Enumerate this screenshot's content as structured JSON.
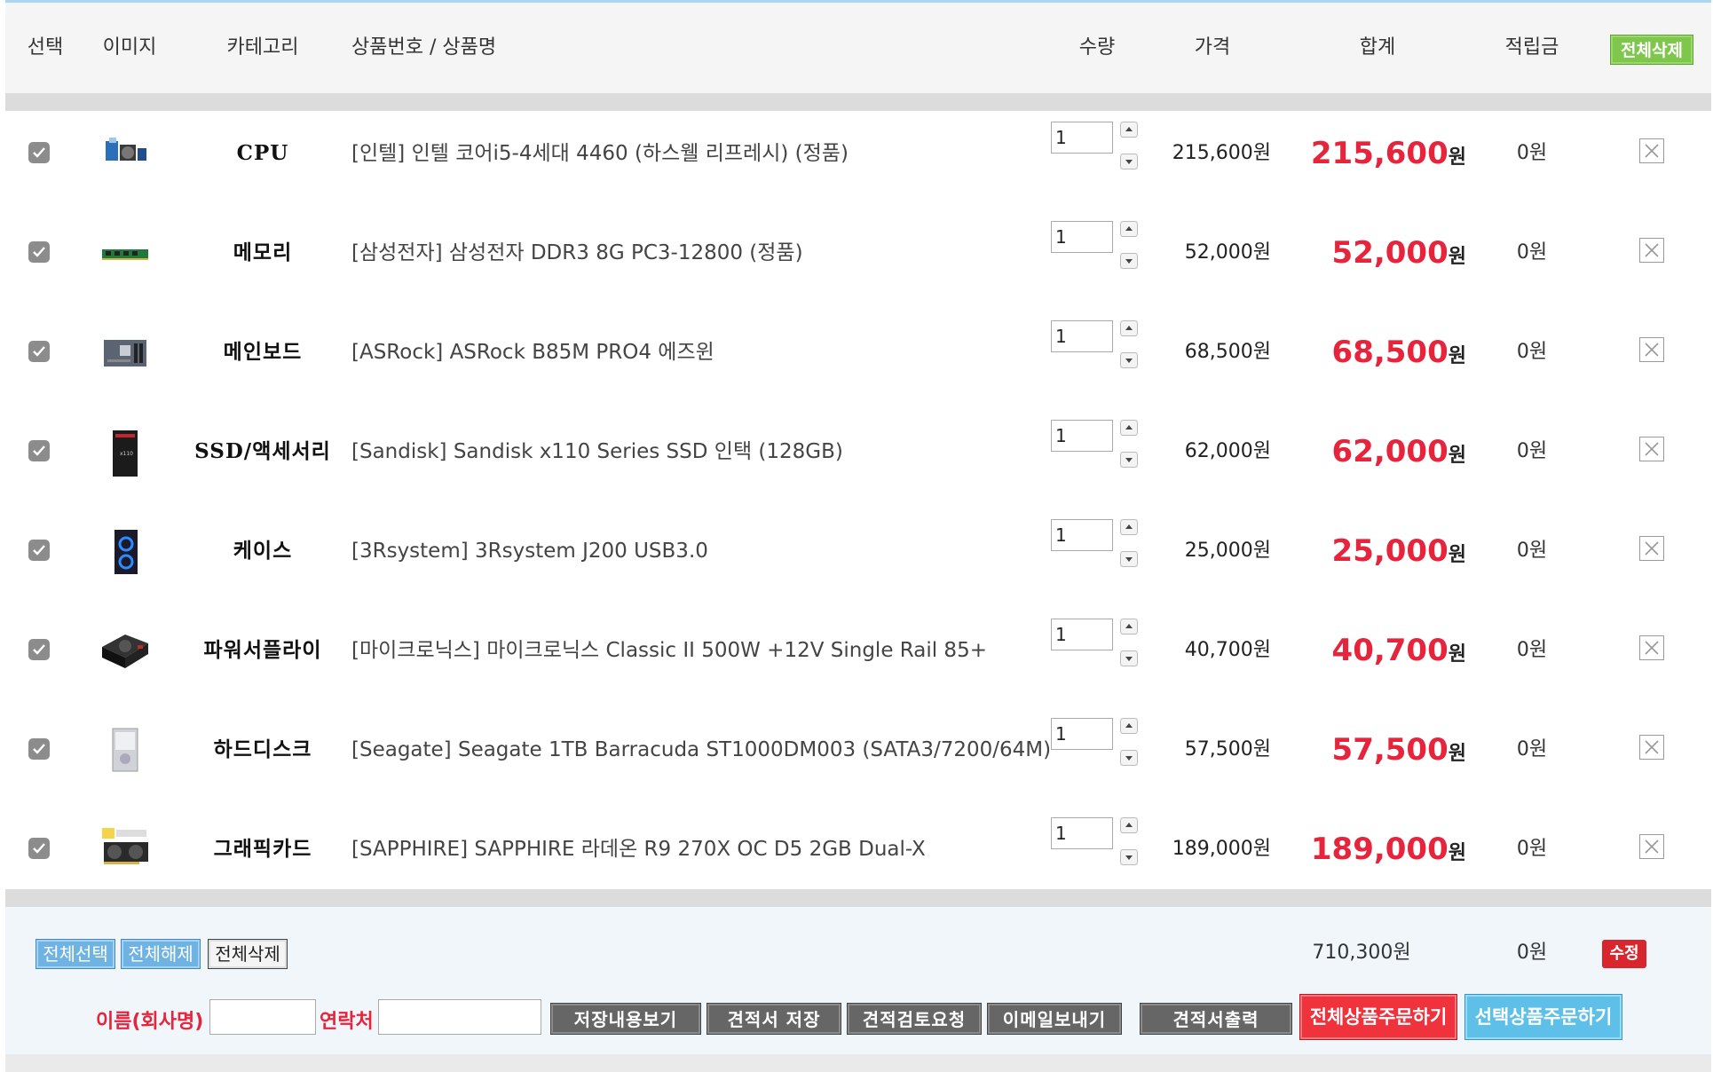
{
  "header": {
    "col_select": "선택",
    "col_image": "이미지",
    "col_category": "카테고리",
    "col_product": "상품번호 / 상품명",
    "col_qty": "수량",
    "col_price": "가격",
    "col_total": "합계",
    "col_points": "적립금",
    "delete_all_label": "전체삭제"
  },
  "rows": [
    {
      "category": "CPU",
      "name": "[인텔] 인텔 코어i5-4세대 4460 (하스웰 리프레시) (정품)",
      "qty": "1",
      "price": "215,600원",
      "total": "215,600",
      "won": "원",
      "points": "0원",
      "thumb": "cpu-thumb"
    },
    {
      "category": "메모리",
      "name": "[삼성전자] 삼성전자 DDR3 8G PC3-12800 (정품)",
      "qty": "1",
      "price": "52,000원",
      "total": "52,000",
      "won": "원",
      "points": "0원",
      "thumb": "memory-thumb"
    },
    {
      "category": "메인보드",
      "name": "[ASRock] ASRock B85M PRO4 에즈윈",
      "qty": "1",
      "price": "68,500원",
      "total": "68,500",
      "won": "원",
      "points": "0원",
      "thumb": "mainboard-thumb"
    },
    {
      "category": "SSD/액세서리",
      "name": "[Sandisk] Sandisk x110 Series SSD 인택 (128GB)",
      "qty": "1",
      "price": "62,000원",
      "total": "62,000",
      "won": "원",
      "points": "0원",
      "thumb": "ssd-thumb"
    },
    {
      "category": "케이스",
      "name": "[3Rsystem] 3Rsystem J200 USB3.0",
      "qty": "1",
      "price": "25,000원",
      "total": "25,000",
      "won": "원",
      "points": "0원",
      "thumb": "case-thumb"
    },
    {
      "category": "파워서플라이",
      "name": "[마이크로닉스] 마이크로닉스 Classic II 500W +12V Single Rail 85+",
      "qty": "1",
      "price": "40,700원",
      "total": "40,700",
      "won": "원",
      "points": "0원",
      "thumb": "psu-thumb"
    },
    {
      "category": "하드디스크",
      "name": "[Seagate] Seagate 1TB Barracuda ST1000DM003 (SATA3/7200/64M)",
      "qty": "1",
      "price": "57,500원",
      "total": "57,500",
      "won": "원",
      "points": "0원",
      "thumb": "hdd-thumb"
    },
    {
      "category": "그래픽카드",
      "name": "[SAPPHIRE] SAPPHIRE 라데온 R9 270X OC D5 2GB Dual-X",
      "qty": "1",
      "price": "189,000원",
      "total": "189,000",
      "won": "원",
      "points": "0원",
      "thumb": "gpu-thumb"
    }
  ],
  "footer": {
    "select_all": "전체선택",
    "deselect_all": "전체해제",
    "delete_all": "전체삭제",
    "sum_total": "710,300원",
    "sum_points": "0원",
    "edit": "수정",
    "name_label": "이름(회사명)",
    "contact_label": "연락처",
    "name_value": "",
    "contact_value": "",
    "btn_view_saved": "저장내용보기",
    "btn_save_estimate": "견적서 저장",
    "btn_request_review": "견적검토요청",
    "btn_send_email": "이메일보내기",
    "btn_print_estimate": "견적서출력",
    "btn_order_all": "전체상품주문하기",
    "btn_order_selected": "선택상품주문하기"
  },
  "colors": {
    "accent_red": "#e6243b",
    "header_green": "#7fc64c",
    "button_blue": "#6eb3e2",
    "button_cyan": "#5ec0e8",
    "button_gray": "#666666"
  }
}
